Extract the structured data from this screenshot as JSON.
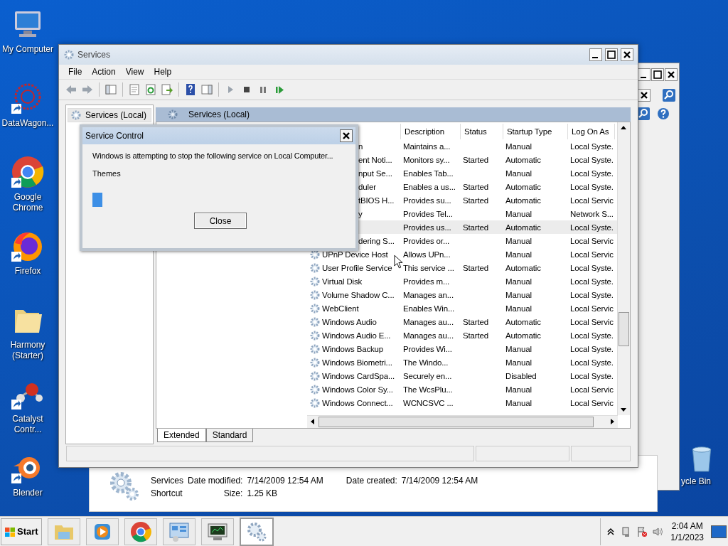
{
  "desktop_icons": [
    {
      "kind": "computer",
      "label": "My Computer",
      "shortcut": false
    },
    {
      "kind": "web",
      "label": "DataWagon...",
      "shortcut": true
    },
    {
      "kind": "chrome",
      "label": "Google Chrome",
      "shortcut": true
    },
    {
      "kind": "firefox",
      "label": "Firefox",
      "shortcut": true
    },
    {
      "kind": "folder",
      "label": "Harmony (Starter)",
      "shortcut": false
    },
    {
      "kind": "molecule",
      "label": "Catalyst Contr...",
      "shortcut": true
    },
    {
      "kind": "blender",
      "label": "Blender",
      "shortcut": true
    }
  ],
  "recycle_bin": {
    "label": "ycle Bin"
  },
  "details_pane": {
    "name": "Services",
    "type": "Shortcut",
    "modified_label": "Date modified:",
    "modified": "7/14/2009 12:54 AM",
    "created_label": "Date created:",
    "created": "7/14/2009 12:54 AM",
    "size_label": "Size:",
    "size": "1.25 KB"
  },
  "window": {
    "title": "Services",
    "menu": [
      "File",
      "Action",
      "View",
      "Help"
    ],
    "tree": {
      "label": "Services (Local)",
      "selected": true
    },
    "pane_header": "Services (Local)",
    "columns": [
      "Description",
      "Status",
      "Startup Type",
      "Log On As"
    ],
    "rows": [
      {
        "name": "n",
        "cut": true,
        "description": "Maintains a...",
        "startup": "Manual",
        "logon": "Local Syste.",
        "selected": false
      },
      {
        "name": "ent Noti...",
        "cut": true,
        "description": "Monitors sy...",
        "status": "Started",
        "startup": "Automatic",
        "logon": "Local Syste.",
        "selected": false
      },
      {
        "name": "nput Se...",
        "cut": true,
        "description": "Enables Tab...",
        "startup": "Manual",
        "logon": "Local Syste.",
        "selected": false
      },
      {
        "name": "duler",
        "cut": true,
        "description": "Enables a us...",
        "status": "Started",
        "startup": "Automatic",
        "logon": "Local Syste.",
        "selected": false
      },
      {
        "name": "tBIOS H...",
        "cut": true,
        "description": "Provides su...",
        "status": "Started",
        "startup": "Automatic",
        "logon": "Local Servic",
        "selected": false
      },
      {
        "name": "y",
        "cut": true,
        "description": "Provides Tel...",
        "startup": "Manual",
        "logon": "Network S...",
        "selected": false
      },
      {
        "cut": true,
        "description": "Provides us...",
        "status": "Started",
        "startup": "Automatic",
        "logon": "Local Syste.",
        "selected": true
      },
      {
        "name": "dering S...",
        "cut": true,
        "description": "Provides or...",
        "startup": "Manual",
        "logon": "Local Servic",
        "selected": false
      },
      {
        "name": "UPnP Device Host",
        "cut": false,
        "description": "Allows UPn...",
        "startup": "Manual",
        "logon": "Local Servic",
        "selected": false
      },
      {
        "name": "User Profile Service",
        "cut": false,
        "description": "This service ...",
        "status": "Started",
        "startup": "Automatic",
        "logon": "Local Syste.",
        "selected": false
      },
      {
        "name": "Virtual Disk",
        "cut": false,
        "description": "Provides m...",
        "startup": "Manual",
        "logon": "Local Syste.",
        "selected": false
      },
      {
        "name": "Volume Shadow C...",
        "cut": false,
        "description": "Manages an...",
        "startup": "Manual",
        "logon": "Local Syste.",
        "selected": false
      },
      {
        "name": "WebClient",
        "cut": false,
        "description": "Enables Win...",
        "startup": "Manual",
        "logon": "Local Servic",
        "selected": false
      },
      {
        "name": "Windows Audio",
        "cut": false,
        "description": "Manages au...",
        "status": "Started",
        "startup": "Automatic",
        "logon": "Local Servic",
        "selected": false
      },
      {
        "name": "Windows Audio E...",
        "cut": false,
        "description": "Manages au...",
        "status": "Started",
        "startup": "Automatic",
        "logon": "Local Syste.",
        "selected": false
      },
      {
        "name": "Windows Backup",
        "cut": false,
        "description": "Provides Wi...",
        "startup": "Manual",
        "logon": "Local Syste.",
        "selected": false
      },
      {
        "name": "Windows Biometri...",
        "cut": false,
        "description": "The Windo...",
        "startup": "Manual",
        "logon": "Local Syste.",
        "selected": false
      },
      {
        "name": "Windows CardSpa...",
        "cut": false,
        "description": "Securely en...",
        "startup": "Disabled",
        "logon": "Local Syste.",
        "selected": false
      },
      {
        "name": "Windows Color Sy...",
        "cut": false,
        "description": "The WcsPlu...",
        "startup": "Manual",
        "logon": "Local Servic",
        "selected": false
      },
      {
        "name": "Windows Connect...",
        "cut": false,
        "description": "WCNCSVC ...",
        "startup": "Manual",
        "logon": "Local Servic",
        "selected": false
      }
    ],
    "tabs": [
      {
        "label": "Extended",
        "selected": true
      },
      {
        "label": "Standard",
        "selected": false
      }
    ]
  },
  "dialog": {
    "title": "Service Control",
    "message": "Windows is attempting to stop the following service on Local Computer...",
    "service": "Themes",
    "level": 0.04,
    "button": "Close"
  },
  "taskbar": {
    "start": "Start",
    "items": [
      {
        "kind": "explorer",
        "selected": false
      },
      {
        "kind": "media",
        "selected": false
      },
      {
        "kind": "chrome",
        "selected": false
      },
      {
        "kind": "panel",
        "selected": false
      },
      {
        "kind": "monitor",
        "selected": false
      },
      {
        "kind": "services",
        "selected": true
      }
    ],
    "time": "2:04 AM",
    "date": "1/1/2023"
  }
}
